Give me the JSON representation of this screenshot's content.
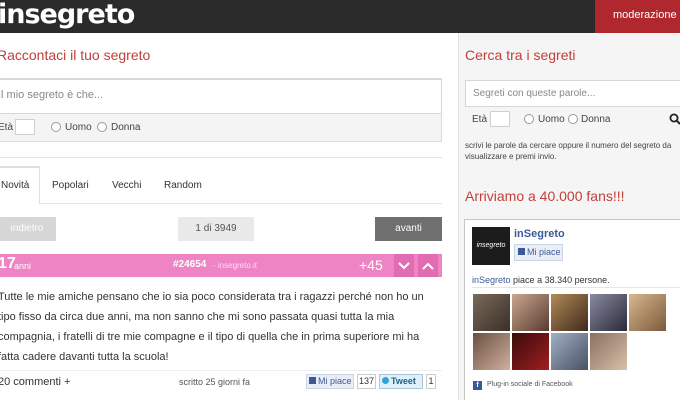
{
  "header": {
    "logo": "insegreto",
    "moderation_label": "moderazione"
  },
  "composer": {
    "title": "Raccontaci il tuo segreto",
    "placeholder": "Il mio segreto è che...",
    "age_label": "Età",
    "gender_male": "Uomo",
    "gender_female": "Donna"
  },
  "tabs": [
    "Novità",
    "Popolari",
    "Vecchi",
    "Random"
  ],
  "pagination": {
    "back": "indietro",
    "info": "1 di 3949",
    "next": "avanti"
  },
  "secret": {
    "age": "17",
    "age_unit": "anni",
    "id": "#24654",
    "source": "- insegreto.it",
    "score": "+45",
    "text": "Tutte le mie amiche pensano che io sia poco considerata tra i ragazzi perché non ho un tipo fisso da circa due anni, ma non sanno che mi sono passata quasi tutta la mia compagnia, i fratelli di tre mie compagne e il tipo di quella che in prima superiore mi ha fatta cadere davanti tutta la scuola!",
    "comments": "20 commenti +",
    "written": "scritto 25 giorni fa",
    "fb_like": "Mi piace",
    "fb_count": "137",
    "tweet": "Tweet",
    "tweet_count": "1"
  },
  "sidebar": {
    "search_title": "Cerca tra i segreti",
    "search_placeholder": "Segreti con queste parole...",
    "age_label": "Età",
    "gender_male": "Uomo",
    "gender_female": "Donna",
    "search_help": "scrivi le parole da cercare oppure il numero del segreto da visualizzare e premi invio.",
    "fans_title": "Arriviamo a 40.000 fans!!!",
    "fb_thumb": "insegreto",
    "fb_page_name": "inSegreto",
    "fb_like": "Mi piace",
    "fb_count_link": "inSegreto",
    "fb_count_text": "piace a 38.340 persone.",
    "fb_plugin": "Plug-in sociale di Facebook"
  },
  "colors": {
    "accent_red": "#b0282e",
    "title_red": "#c1403a",
    "pink_bar": "#ee84c4",
    "dark_header": "#2b2b2b"
  }
}
